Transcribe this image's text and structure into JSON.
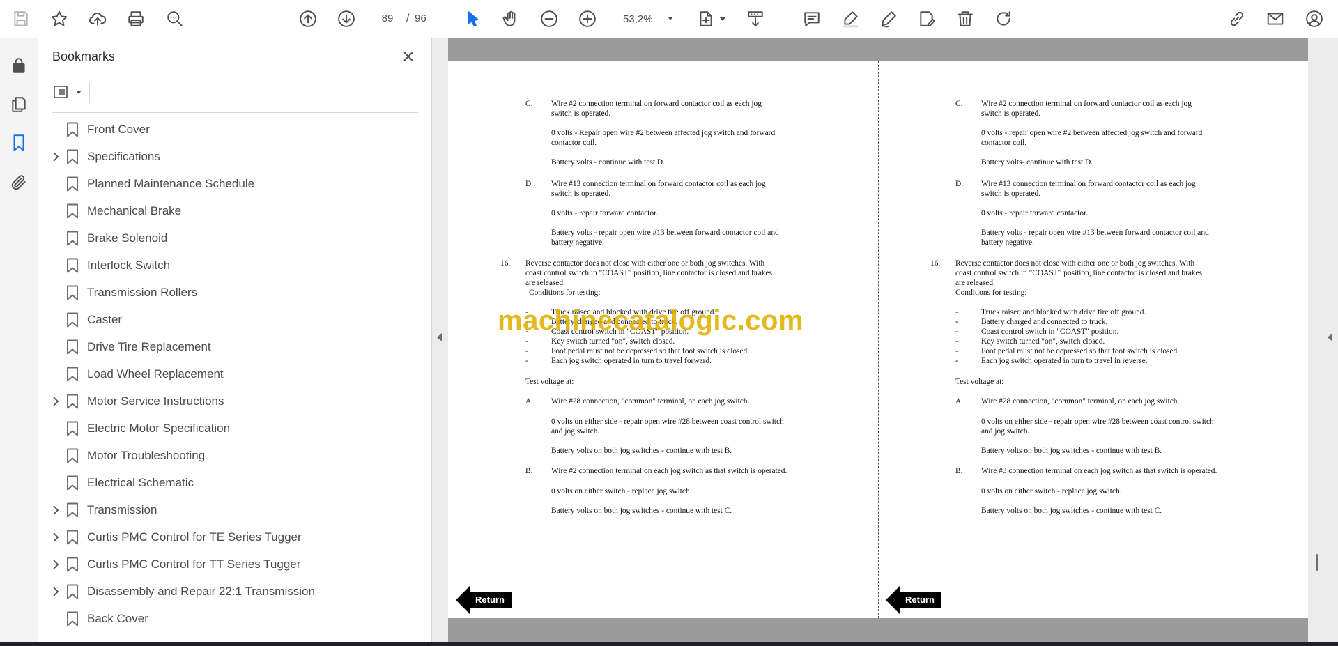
{
  "toolbar": {
    "current_page": "89",
    "page_separator": "/",
    "total_pages": "96",
    "zoom": "53,2%"
  },
  "bookmarks": {
    "title": "Bookmarks",
    "items": [
      {
        "label": "Front Cover",
        "expandable": false
      },
      {
        "label": "Specifications",
        "expandable": true
      },
      {
        "label": "Planned Maintenance Schedule",
        "expandable": false
      },
      {
        "label": "Mechanical Brake",
        "expandable": false
      },
      {
        "label": "Brake Solenoid",
        "expandable": false
      },
      {
        "label": "Interlock Switch",
        "expandable": false
      },
      {
        "label": "Transmission Rollers",
        "expandable": false
      },
      {
        "label": "Caster",
        "expandable": false
      },
      {
        "label": "Drive Tire Replacement",
        "expandable": false
      },
      {
        "label": "Load Wheel Replacement",
        "expandable": false
      },
      {
        "label": "Motor Service Instructions",
        "expandable": true
      },
      {
        "label": "Electric Motor Specification",
        "expandable": false
      },
      {
        "label": "Motor Troubleshooting",
        "expandable": false
      },
      {
        "label": "Electrical Schematic",
        "expandable": false
      },
      {
        "label": "Transmission",
        "expandable": true
      },
      {
        "label": "Curtis PMC Control for TE Series Tugger",
        "expandable": true
      },
      {
        "label": "Curtis PMC Control for TT Series Tugger",
        "expandable": true
      },
      {
        "label": "Disassembly and Repair 22:1 Transmission",
        "expandable": true
      },
      {
        "label": "Back Cover",
        "expandable": false
      }
    ]
  },
  "left_page": {
    "c_letter": "C.",
    "c_text": "Wire #2 connection terminal on forward contactor coil as each jog switch is operated.",
    "c_zero": "0 volts - Repair open wire #2 between affected jog switch and forward contactor coil.",
    "c_batt": "Battery volts - continue with test D.",
    "d_letter": "D.",
    "d_text": "Wire #13 connection terminal on forward contactor coil as each jog switch is operated.",
    "d_zero": "0 volts - repair forward contactor.",
    "d_batt": "Battery volts - repair open wire #13 between forward contactor coil and battery negative.",
    "n16": "16.",
    "n16_text": "Reverse contactor does not close with either one or both jog switches.  With coast control switch in \"COAST\" position, line contactor is closed and brakes are released.",
    "conditions": "Conditions for testing:",
    "conds": [
      "Truck raised and blocked with drive tire off ground.",
      "Battery charged and connected to truck.",
      "Coast control switch in \"COAST\" position.",
      "Key switch turned \"on\", switch closed.",
      "Foot pedal must not be depressed so that foot switch is closed.",
      "Each jog switch operated in turn to travel forward."
    ],
    "test_voltage": "Test voltage at:",
    "a_letter": "A.",
    "a_text": "Wire #28 connection, \"common\" terminal, on each jog switch.",
    "a_zero": "0 volts on either side - repair open wire #28 between coast control switch and jog switch.",
    "a_batt": "Battery volts on both jog switches - continue with test B.",
    "b_letter": "B.",
    "b_text": "Wire #2 connection terminal on each jog switch as that switch is operated.",
    "b_zero": "0 volts on either switch - replace jog switch.",
    "b_batt": "Battery volts on both jog switches - continue with test C.",
    "return": "Return"
  },
  "right_page": {
    "c_letter": "C.",
    "c_text": "Wire #2 connection terminal on forward contactor coil as each jog switch is operated.",
    "c_zero": "0 volts - repair open wire #2 between affected jog switch and forward contactor coil.",
    "c_batt": "Battery volts- continue with test D.",
    "d_letter": "D.",
    "d_text": "Wire #13 connection terminal on forward contactor coil as each jog switch is operated.",
    "d_zero": "0 volts - repair forward contactor.",
    "d_batt": "Battery volts - repair open wire #13 between forward contactor coil and battery negative.",
    "n16": "16.",
    "n16_text": "Reverse contactor does not  close with either one or both jog switches.  With coast control switch in \"COAST\" position, line contactor is closed and brakes are released.",
    "conditions": "Conditions for testing:",
    "conds": [
      "Truck raised and blocked with drive tire off ground.",
      "Battery charged and connected to truck.",
      "Coast control switch in \"COAST\" position.",
      "Key switch turned \"on\", switch closed.",
      "Foot pedal must not be depressed so that foot switch is closed.",
      "Each jog switch operated in turn to travel in reverse."
    ],
    "test_voltage": "Test voltage at:",
    "a_letter": "A.",
    "a_text": "Wire #28 connection, \"common\" terminal, on each jog switch.",
    "a_zero": "0 volts on either side - repair open wire #28 between coast control switch and jog switch.",
    "a_batt": "Battery volts on both jog switches - continue with test B.",
    "b_letter": "B.",
    "b_text": "Wire #3 connection terminal on each jog switch as that switch is operated.",
    "b_zero": "0 volts on either switch - replace jog switch.",
    "b_batt": "Battery volts on both jog switches - continue with test C.",
    "return": "Return"
  },
  "watermark": "machinecatalogic.com",
  "colors": {
    "accent": "#1473e6",
    "watermark": "#e0b000"
  }
}
